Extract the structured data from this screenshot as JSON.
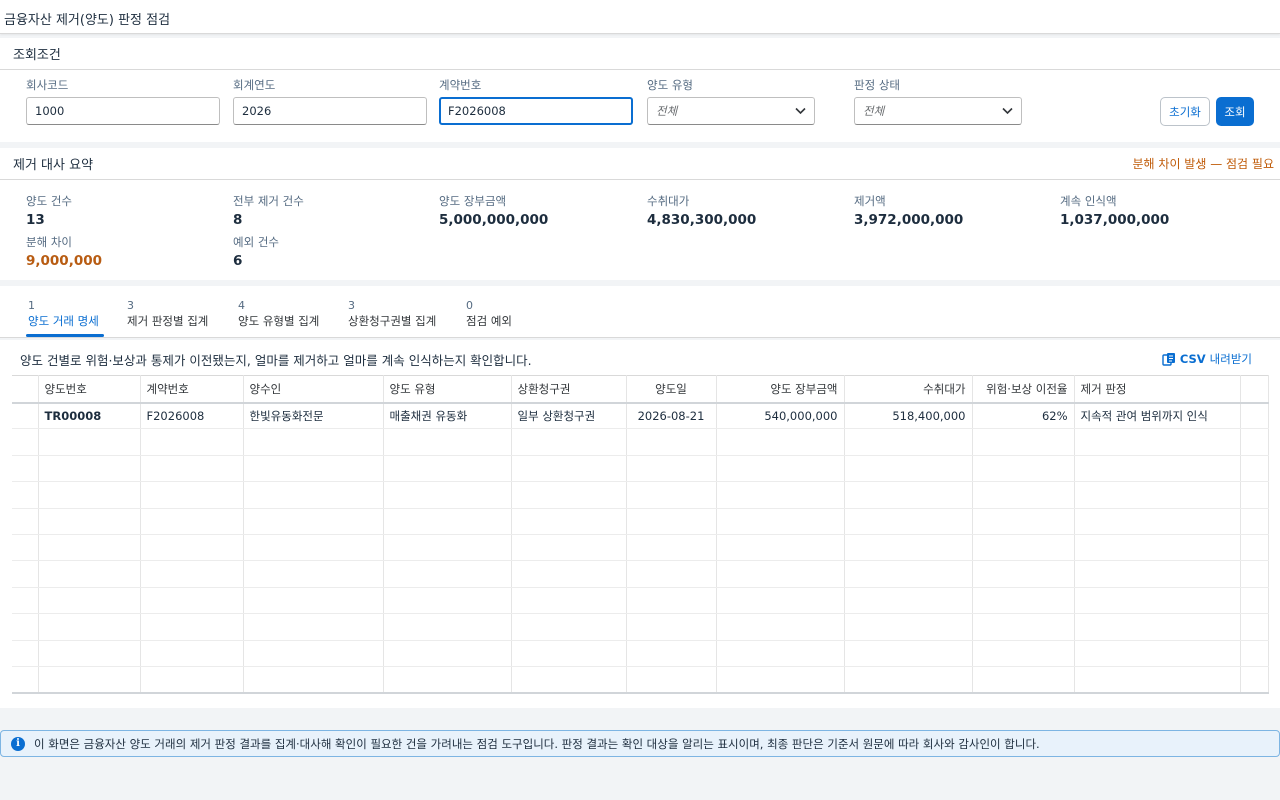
{
  "page": {
    "title": "금융자산 제거(양도) 판정 점검"
  },
  "filter": {
    "section_title": "조회조건",
    "fields": [
      {
        "label": "회사코드",
        "value": "1000"
      },
      {
        "label": "회계연도",
        "value": "2026"
      },
      {
        "label": "계약번호",
        "value": "F2026008"
      },
      {
        "label": "양도 유형",
        "value": "전체"
      },
      {
        "label": "판정 상태",
        "value": "전체"
      }
    ],
    "reset_label": "초기화",
    "search_label": "조회"
  },
  "summary": {
    "section_title": "제거 대사 요약",
    "warning": "분해 차이 발생 — 점검 필요",
    "kpis": [
      {
        "label": "양도 건수",
        "value": "13"
      },
      {
        "label": "전부 제거 건수",
        "value": "8"
      },
      {
        "label": "양도 장부금액",
        "value": "5,000,000,000"
      },
      {
        "label": "수취대가",
        "value": "4,830,300,000"
      },
      {
        "label": "제거액",
        "value": "3,972,000,000"
      },
      {
        "label": "계속 인식액",
        "value": "1,037,000,000"
      },
      {
        "label": "분해 차이",
        "value": "9,000,000"
      },
      {
        "label": "예외 건수",
        "value": "6"
      }
    ],
    "colors": {
      "warning": "#c05c0a",
      "accent": "#0a6ed1"
    }
  },
  "tabs": [
    {
      "count": "1",
      "label": "양도 거래 명세"
    },
    {
      "count": "3",
      "label": "제거 판정별 집계"
    },
    {
      "count": "4",
      "label": "양도 유형별 집계"
    },
    {
      "count": "3",
      "label": "상환청구권별 집계"
    },
    {
      "count": "0",
      "label": "점검 예외"
    }
  ],
  "table": {
    "description": "양도 건별로 위험·보상과 통제가 이전됐는지, 얼마를 제거하고 얼마를 계속 인식하는지 확인합니다.",
    "csv_label": "CSV",
    "csv_suffix": "내려받기",
    "csv_icon": "csv-file-icon",
    "columns": [
      "양도번호",
      "계약번호",
      "양수인",
      "양도 유형",
      "상환청구권",
      "양도일",
      "양도 장부금액",
      "수취대가",
      "위험·보상 이전율",
      "제거 판정"
    ],
    "rows": [
      [
        "TR00008",
        "F2026008",
        "한빛유동화전문",
        "매출채권 유동화",
        "일부 상환청구권",
        "2026-08-21",
        "540,000,000",
        "518,400,000",
        "62%",
        "지속적 관여 범위까지 인식"
      ]
    ]
  },
  "message": {
    "icon": "info-icon",
    "text": "이 화면은 금융자산 양도 거래의 제거 판정 결과를 집계·대사해 확인이 필요한 건을 가려내는 점검 도구입니다. 판정 결과는 확인 대상을 알리는 표시이며, 최종 판단은 기준서 원문에 따라 회사와 감사인이 합니다."
  }
}
